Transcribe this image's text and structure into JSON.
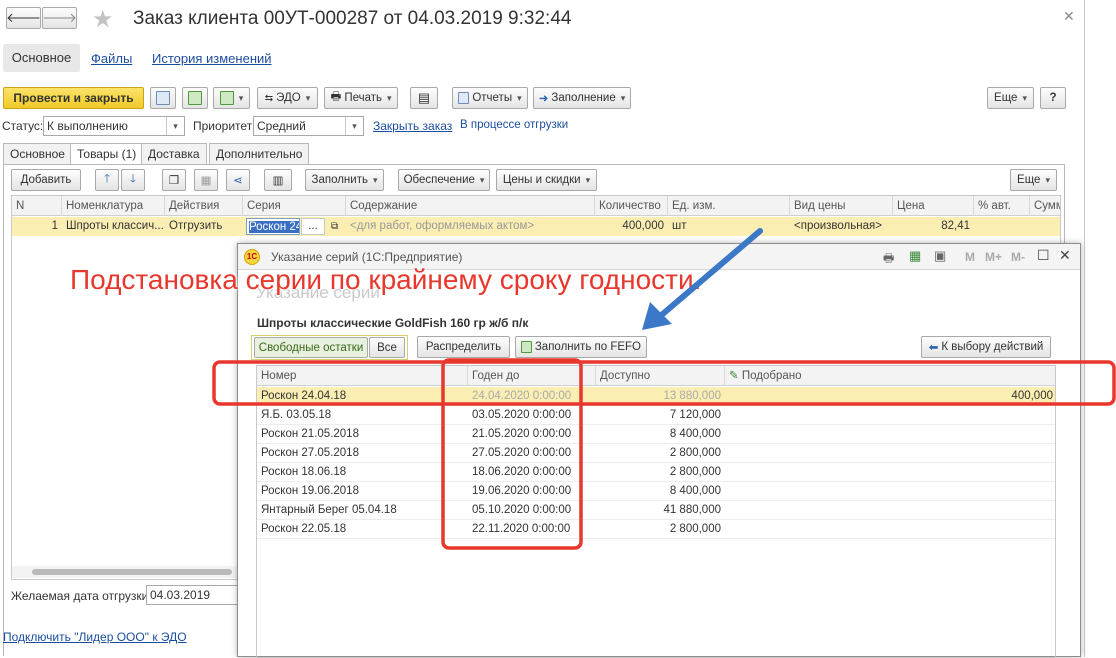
{
  "window": {
    "title": "Заказ клиента 00УТ-000287 от 04.03.2019 9:32:44"
  },
  "top_tabs": [
    "Основное",
    "Файлы",
    "История изменений"
  ],
  "toolbar": {
    "post_close": "Провести и закрыть",
    "edo": "ЭДО",
    "print": "Печать",
    "reports": "Отчеты",
    "fill": "Заполнение",
    "more": "Еще",
    "help": "?"
  },
  "status": {
    "label": "Статус:",
    "value": "К выполнению",
    "priority_label": "Приоритет:",
    "priority_value": "Средний",
    "close_link": "Закрыть заказ",
    "shipping_link": "В процессе отгрузки"
  },
  "form_tabs": [
    "Основное",
    "Товары (1)",
    "Доставка",
    "Дополнительно"
  ],
  "goods_toolbar": {
    "add": "Добавить",
    "fill": "Заполнить",
    "supply": "Обеспечение",
    "prices": "Цены и скидки",
    "more": "Еще"
  },
  "goods_table": {
    "columns": [
      "N",
      "Номенклатура",
      "Действия",
      "Серия",
      "Содержание",
      "Количество",
      "Ед. изм.",
      "Вид цены",
      "Цена",
      "% авт.",
      "Сумм"
    ],
    "row": {
      "n": "1",
      "item": "Шпроты классич...",
      "action": "Отгрузить",
      "series": "Роскон 24",
      "series_btn": "...",
      "content": "<для работ, оформляемых актом>",
      "qty": "400,000",
      "unit": "шт",
      "price_type": "<произвольная>",
      "price": "82,41"
    }
  },
  "footer": {
    "ship_date_label": "Желаемая дата отгрузки:",
    "ship_date_value": "04.03.2019",
    "edo_link": "Подключить \"Лидер ООО\" к ЭДО"
  },
  "dialog": {
    "title": "Указание серий  (1С:Предприятие)",
    "title_icons": {
      "m": "M",
      "mplus": "M+",
      "mminus": "M-"
    },
    "subtitle": "Указание серий",
    "product": "Шпроты классические GoldFish 160 гр ж/б п/к",
    "btn_free": "Свободные остатки",
    "btn_all": "Все",
    "btn_distribute": "Распределить",
    "btn_fefo": "Заполнить по FEFO",
    "btn_back": "К выбору действий",
    "columns": [
      "Номер",
      "Годен до",
      "Доступно",
      "Подобрано"
    ],
    "rows": [
      {
        "num": "Роскон 24.04.18",
        "until": "24.04.2020 0:00:00",
        "avail": "13 880,000",
        "picked": "400,000"
      },
      {
        "num": "Я.Б. 03.05.18",
        "until": "03.05.2020 0:00:00",
        "avail": "7 120,000",
        "picked": ""
      },
      {
        "num": "Роскон 21.05.2018",
        "until": "21.05.2020 0:00:00",
        "avail": "8 400,000",
        "picked": ""
      },
      {
        "num": "Роскон 27.05.2018",
        "until": "27.05.2020 0:00:00",
        "avail": "2 800,000",
        "picked": ""
      },
      {
        "num": "Роскон 18.06.18",
        "until": "18.06.2020 0:00:00",
        "avail": "2 800,000",
        "picked": ""
      },
      {
        "num": "Роскон 19.06.2018",
        "until": "19.06.2020 0:00:00",
        "avail": "8 400,000",
        "picked": ""
      },
      {
        "num": "Янтарный Берег 05.04.18",
        "until": "05.10.2020 0:00:00",
        "avail": "41 880,000",
        "picked": ""
      },
      {
        "num": "Роскон 22.05.18",
        "until": "22.11.2020 0:00:00",
        "avail": "2 800,000",
        "picked": ""
      }
    ]
  },
  "annotation": {
    "text": "Подстановка серии по крайнему сроку годности.",
    "color": "#e8372c"
  },
  "colors": {
    "accent_yellow": "#f5d53c",
    "selected_row": "#fbeeb2",
    "annotation": "#e8372c",
    "arrow": "#3b78c8"
  }
}
